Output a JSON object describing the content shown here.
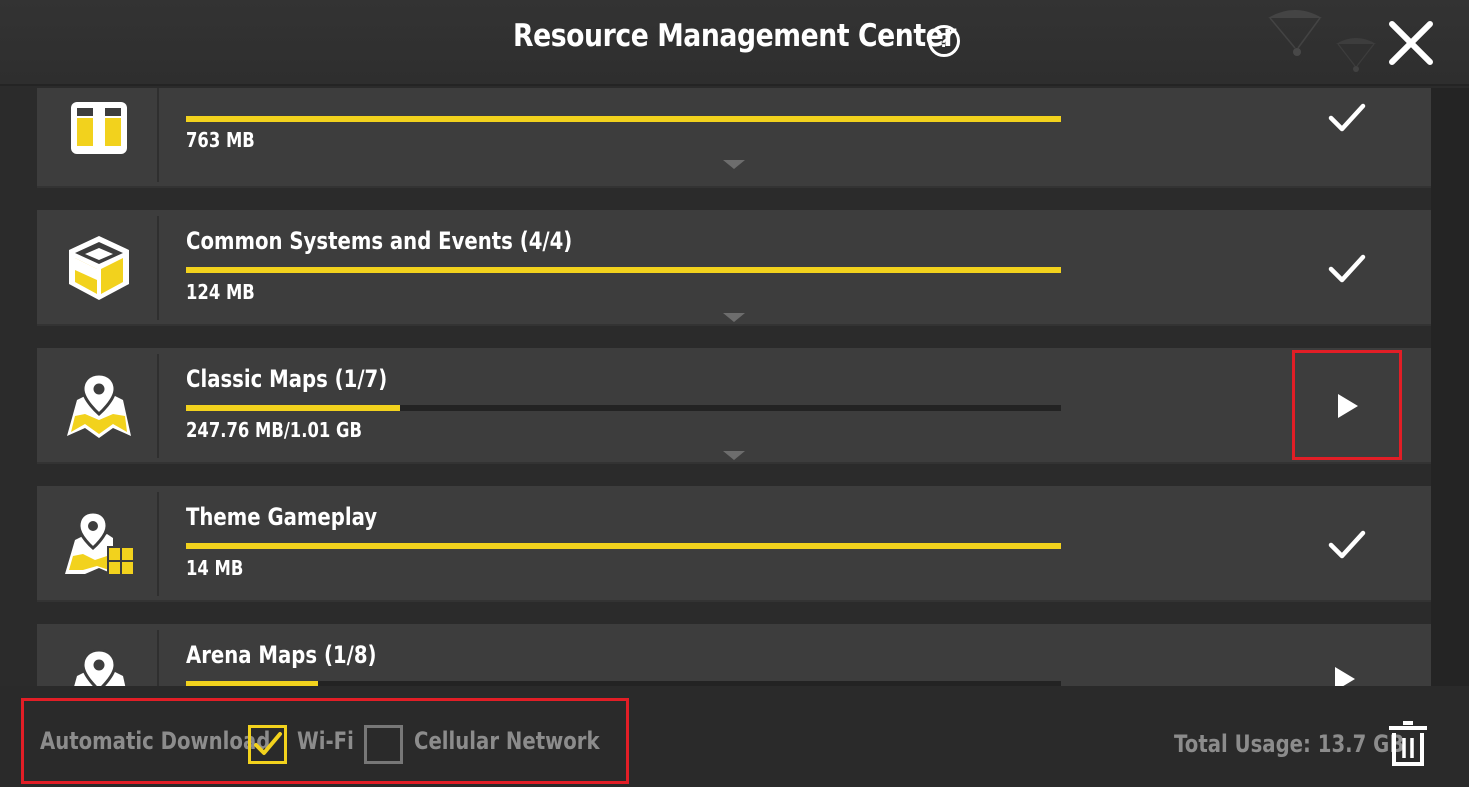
{
  "header": {
    "title": "Resource Management Center",
    "help_glyph": "?"
  },
  "colors": {
    "accent": "#f2d21d",
    "highlight": "#e21e26",
    "panel": "#3d3d3d"
  },
  "items": [
    {
      "title": "",
      "size": "763 MB",
      "progress": 1.0,
      "status": "downloaded",
      "icon": "box-icon"
    },
    {
      "title": "Common Systems and Events (4/4)",
      "size": "124 MB",
      "progress": 1.0,
      "status": "downloaded",
      "icon": "cube-icon"
    },
    {
      "title": "Classic Maps (1/7)",
      "size": "247.76 MB/1.01 GB",
      "progress": 0.245,
      "status": "paused",
      "icon": "map-pin-icon"
    },
    {
      "title": "Theme Gameplay",
      "size": "14 MB",
      "progress": 1.0,
      "status": "downloaded",
      "icon": "map-grid-icon"
    },
    {
      "title": "Arena Maps (1/8)",
      "size": "",
      "progress": 0.151,
      "status": "paused",
      "icon": "map-pin-icon"
    }
  ],
  "footer": {
    "auto_download_label": "Automatic Download",
    "wifi_label": "Wi-Fi",
    "wifi_checked": true,
    "cellular_label": "Cellular Network",
    "cellular_checked": false,
    "total_usage": "Total Usage: 13.7 GB"
  }
}
